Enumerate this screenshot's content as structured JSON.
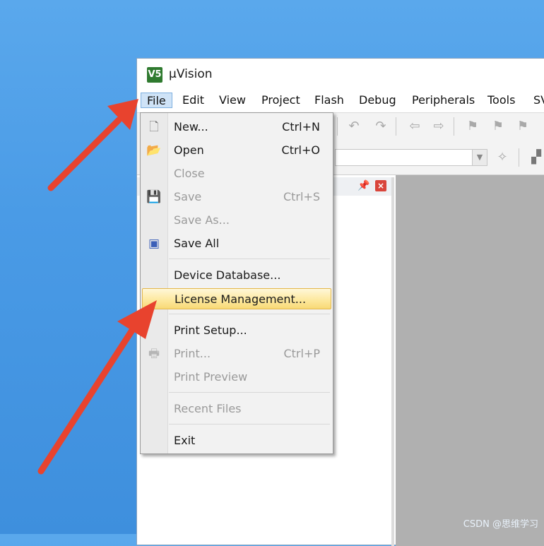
{
  "window": {
    "title": "µVision",
    "icon_label": "V5"
  },
  "menubar": {
    "items": [
      "File",
      "Edit",
      "View",
      "Project",
      "Flash",
      "Debug",
      "Peripherals",
      "Tools",
      "SV"
    ],
    "active": "File"
  },
  "file_menu": {
    "items": [
      {
        "label": "New...",
        "shortcut": "Ctrl+N",
        "icon": "new-file-icon",
        "disabled": false
      },
      {
        "label": "Open",
        "shortcut": "Ctrl+O",
        "icon": "folder-open-icon",
        "disabled": false
      },
      {
        "label": "Close",
        "shortcut": "",
        "icon": "",
        "disabled": true
      },
      {
        "label": "Save",
        "shortcut": "Ctrl+S",
        "icon": "save-icon",
        "disabled": true
      },
      {
        "label": "Save As...",
        "shortcut": "",
        "icon": "",
        "disabled": true
      },
      {
        "label": "Save All",
        "shortcut": "",
        "icon": "save-all-icon",
        "disabled": false
      },
      {
        "label": "Device Database...",
        "shortcut": "",
        "icon": "",
        "disabled": false
      },
      {
        "label": "License Management...",
        "shortcut": "",
        "icon": "",
        "disabled": false,
        "highlighted": true
      },
      {
        "label": "Print Setup...",
        "shortcut": "",
        "icon": "",
        "disabled": false
      },
      {
        "label": "Print...",
        "shortcut": "Ctrl+P",
        "icon": "printer-icon",
        "disabled": true
      },
      {
        "label": "Print Preview",
        "shortcut": "",
        "icon": "",
        "disabled": true
      },
      {
        "label": "Recent Files",
        "shortcut": "",
        "icon": "",
        "disabled": true
      },
      {
        "label": "Exit",
        "shortcut": "",
        "icon": "",
        "disabled": false
      }
    ]
  },
  "watermark": "CSDN @思维学习",
  "colors": {
    "desktop": "#4a9be6",
    "highlight": "#fde9a0",
    "arrow": "#e8432e",
    "workspace": "#b0b0b0"
  }
}
